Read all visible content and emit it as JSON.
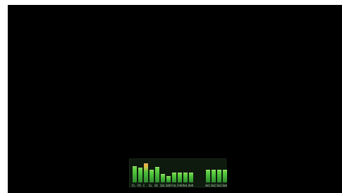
{
  "meter": {
    "channels": [
      {
        "label": "FL",
        "level": 0.78,
        "peak": false
      },
      {
        "label": "FR",
        "level": 0.72,
        "peak": false
      },
      {
        "label": "C",
        "level": 0.92,
        "peak": true
      },
      {
        "label": "SL",
        "level": 0.62,
        "peak": false
      },
      {
        "label": "SR",
        "level": 0.76,
        "peak": false
      },
      {
        "label": "SBL",
        "level": 0.4,
        "peak": false
      },
      {
        "label": "SBR",
        "level": 0.3,
        "peak": false
      },
      {
        "label": "FHL",
        "level": 0.45,
        "peak": false
      },
      {
        "label": "FHR",
        "level": 0.45,
        "peak": false
      },
      {
        "label": "RHL",
        "level": 0.45,
        "peak": false
      },
      {
        "label": "RHR",
        "level": 0.45,
        "peak": false
      },
      {
        "label": "SW1",
        "level": 0.62,
        "peak": false
      },
      {
        "label": "SW2",
        "level": 0.62,
        "peak": false
      },
      {
        "label": "SW3",
        "level": 0.62,
        "peak": false
      },
      {
        "label": "SW4",
        "level": 0.62,
        "peak": false
      }
    ]
  }
}
